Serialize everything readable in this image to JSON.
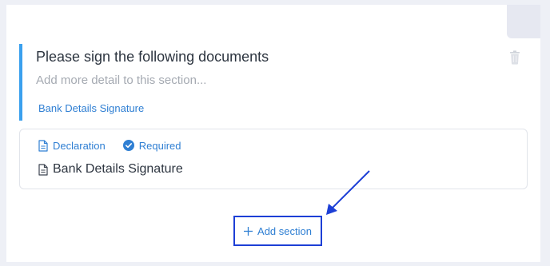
{
  "section": {
    "title": "Please sign the following documents",
    "description_placeholder": "Add more detail to this section...",
    "link_label": "Bank Details Signature",
    "delete_icon": "trash-icon",
    "accent_color": "#3aa0ee"
  },
  "document": {
    "type_label": "Declaration",
    "type_icon": "document-icon",
    "required_label": "Required",
    "required_icon": "check-circle-icon",
    "name": "Bank Details Signature",
    "name_icon": "document-icon"
  },
  "actions": {
    "add_section_label": "Add section",
    "add_icon": "plus-icon"
  },
  "annotation": {
    "color": "#1d3fd6"
  }
}
